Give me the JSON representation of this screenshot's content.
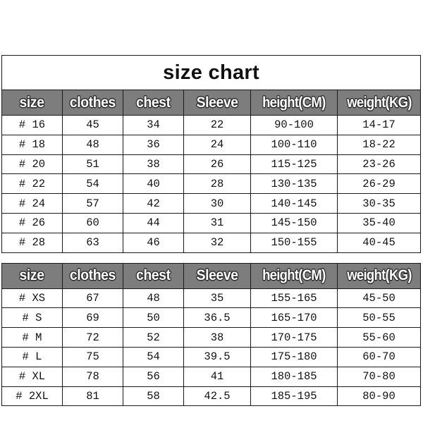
{
  "page": {
    "title": "size chart",
    "background_color": "#ffffff",
    "header_background_color": "#7d7d7d",
    "header_text_color": "#ffffff",
    "grid_color": "#1a1a1a",
    "text_color": "#111111"
  },
  "columns": [
    "size",
    "clothes",
    "chest",
    "Sleeve",
    "height(CM)",
    "weight(KG)"
  ],
  "tables": [
    {
      "id": "kids-size-table",
      "headers": [
        "size",
        "clothes",
        "chest",
        "Sleeve",
        "height(CM)",
        "weight(KG)"
      ],
      "rows": [
        [
          "# 16",
          "45",
          "34",
          "22",
          "90-100",
          "14-17"
        ],
        [
          "# 18",
          "48",
          "36",
          "24",
          "100-110",
          "18-22"
        ],
        [
          "# 20",
          "51",
          "38",
          "26",
          "115-125",
          "23-26"
        ],
        [
          "# 22",
          "54",
          "40",
          "28",
          "130-135",
          "26-29"
        ],
        [
          "# 24",
          "57",
          "42",
          "30",
          "140-145",
          "30-35"
        ],
        [
          "# 26",
          "60",
          "44",
          "31",
          "145-150",
          "35-40"
        ],
        [
          "# 28",
          "63",
          "46",
          "32",
          "150-155",
          "40-45"
        ]
      ]
    },
    {
      "id": "adult-size-table",
      "headers": [
        "size",
        "clothes",
        "chest",
        "Sleeve",
        "height(CM)",
        "weight(KG)"
      ],
      "rows": [
        [
          "# XS",
          "67",
          "48",
          "35",
          "155-165",
          "45-50"
        ],
        [
          "# S",
          "69",
          "50",
          "36.5",
          "165-170",
          "50-55"
        ],
        [
          "# M",
          "72",
          "52",
          "38",
          "170-175",
          "55-60"
        ],
        [
          "# L",
          "75",
          "54",
          "39.5",
          "175-180",
          "60-70"
        ],
        [
          "# XL",
          "78",
          "56",
          "41",
          "180-185",
          "70-80"
        ],
        [
          "# 2XL",
          "81",
          "58",
          "42.5",
          "185-195",
          "80-90"
        ]
      ]
    }
  ],
  "chart_data": {
    "type": "table",
    "title": "size chart",
    "columns": [
      "size",
      "clothes",
      "chest",
      "Sleeve",
      "height(CM)",
      "weight(KG)"
    ],
    "units": {
      "clothes": "cm",
      "chest": "cm",
      "Sleeve": "cm",
      "height(CM)": "cm",
      "weight(KG)": "kg"
    },
    "sections": [
      {
        "name": "youth-numbered-sizes",
        "rows": [
          {
            "size": "# 16",
            "clothes": 45,
            "chest": 34,
            "Sleeve": 22,
            "height(CM)": "90-100",
            "weight(KG)": "14-17"
          },
          {
            "size": "# 18",
            "clothes": 48,
            "chest": 36,
            "Sleeve": 24,
            "height(CM)": "100-110",
            "weight(KG)": "18-22"
          },
          {
            "size": "# 20",
            "clothes": 51,
            "chest": 38,
            "Sleeve": 26,
            "height(CM)": "115-125",
            "weight(KG)": "23-26"
          },
          {
            "size": "# 22",
            "clothes": 54,
            "chest": 40,
            "Sleeve": 28,
            "height(CM)": "130-135",
            "weight(KG)": "26-29"
          },
          {
            "size": "# 24",
            "clothes": 57,
            "chest": 42,
            "Sleeve": 30,
            "height(CM)": "140-145",
            "weight(KG)": "30-35"
          },
          {
            "size": "# 26",
            "clothes": 60,
            "chest": 44,
            "Sleeve": 31,
            "height(CM)": "145-150",
            "weight(KG)": "35-40"
          },
          {
            "size": "# 28",
            "clothes": 63,
            "chest": 46,
            "Sleeve": 32,
            "height(CM)": "150-155",
            "weight(KG)": "40-45"
          }
        ]
      },
      {
        "name": "adult-lettered-sizes",
        "rows": [
          {
            "size": "# XS",
            "clothes": 67,
            "chest": 48,
            "Sleeve": 35,
            "height(CM)": "155-165",
            "weight(KG)": "45-50"
          },
          {
            "size": "# S",
            "clothes": 69,
            "chest": 50,
            "Sleeve": 36.5,
            "height(CM)": "165-170",
            "weight(KG)": "50-55"
          },
          {
            "size": "# M",
            "clothes": 72,
            "chest": 52,
            "Sleeve": 38,
            "height(CM)": "170-175",
            "weight(KG)": "55-60"
          },
          {
            "size": "# L",
            "clothes": 75,
            "chest": 54,
            "Sleeve": 39.5,
            "height(CM)": "175-180",
            "weight(KG)": "60-70"
          },
          {
            "size": "# XL",
            "clothes": 78,
            "chest": 56,
            "Sleeve": 41,
            "height(CM)": "180-185",
            "weight(KG)": "70-80"
          },
          {
            "size": "# 2XL",
            "clothes": 81,
            "chest": 58,
            "Sleeve": 42.5,
            "height(CM)": "185-195",
            "weight(KG)": "80-90"
          }
        ]
      }
    ]
  }
}
